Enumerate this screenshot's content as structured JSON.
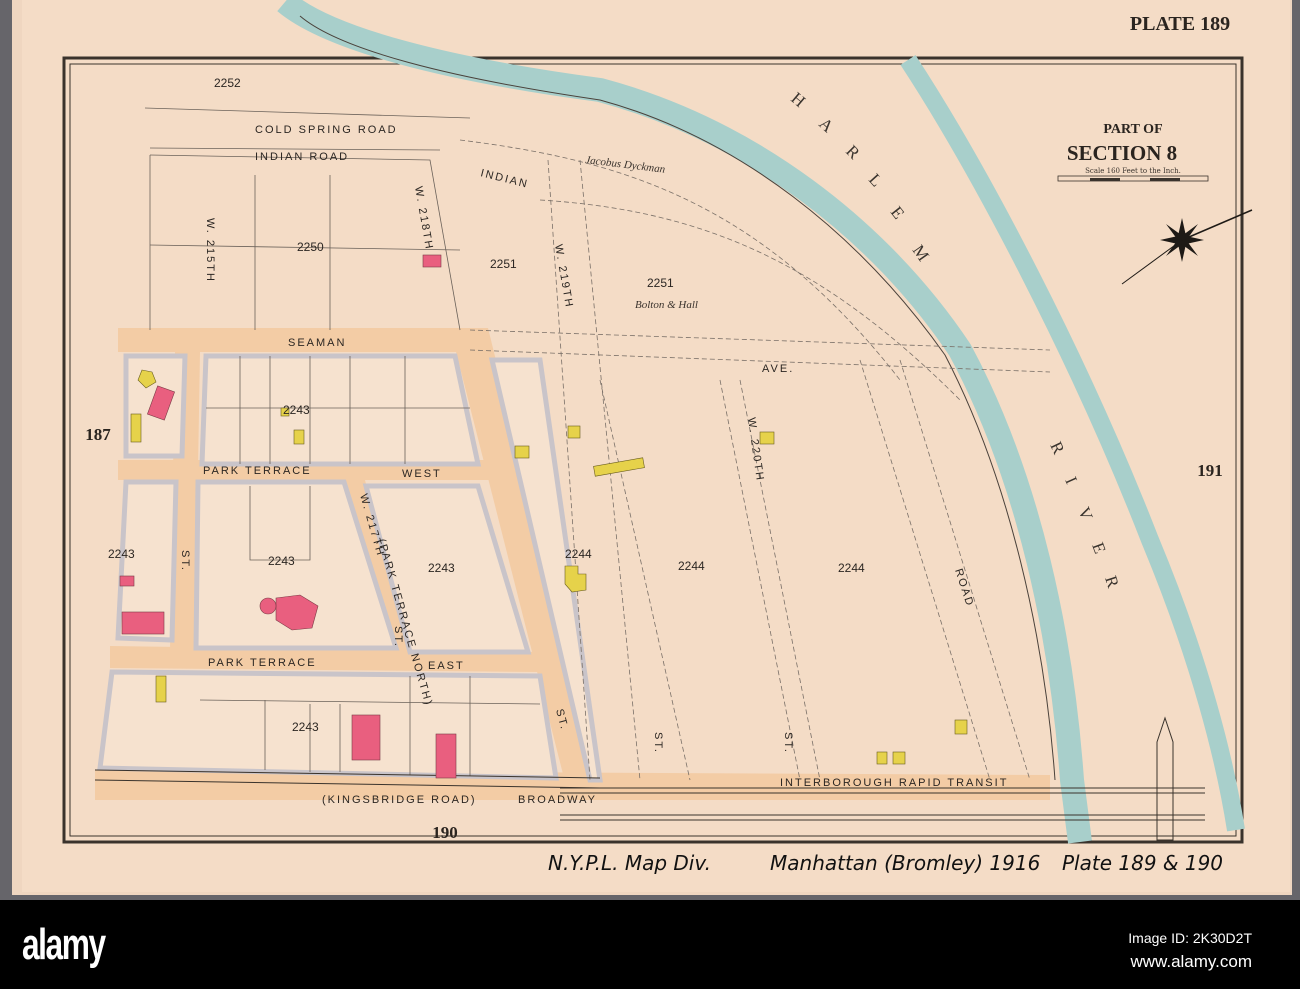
{
  "header": {
    "plate": "PLATE 189",
    "part_of": "PART OF",
    "section": "SECTION 8",
    "scale": "Scale 160 Feet to the Inch."
  },
  "adjacent_plates": {
    "west": "187",
    "east": "191",
    "south": "190"
  },
  "streets": {
    "cold_spring_road": "COLD SPRING ROAD",
    "indian_road": "INDIAN ROAD",
    "indian": "INDIAN",
    "seaman": "SEAMAN",
    "ave": "AVE.",
    "w215": "W. 215TH",
    "w218": "W. 218TH",
    "w219": "W. 219TH",
    "w217": "W. 217TH",
    "park_terrace_north": "(PARK TERRACE NORTH)",
    "w220": "W. 220TH",
    "road": "ROAD",
    "park_terrace": "PARK TERRACE",
    "west": "WEST",
    "east": "EAST",
    "st": "ST.",
    "kingsbridge": "(KINGSBRIDGE ROAD)",
    "broadway": "BROADWAY",
    "transit": "INTERBOROUGH RAPID TRANSIT"
  },
  "water": {
    "harlem": [
      "H",
      "A",
      "R",
      "L",
      "E",
      "M"
    ],
    "river": [
      "R",
      "I",
      "V",
      "E",
      "R"
    ]
  },
  "blocks": {
    "b2252": "2252",
    "b2250": "2250",
    "b2251": "2251",
    "b2243": "2243",
    "b2244": "2244"
  },
  "owners": {
    "dyckman": "Jacobus Dyckman",
    "bolton": "Bolton & Hall"
  },
  "annotation": {
    "nypl": "N.Y.P.L. Map Div.",
    "title": "Manhattan (Bromley) 1916",
    "plates": "Plate 189 & 190"
  },
  "colors": {
    "paper": "#f4dcc6",
    "street": "#f3cca5",
    "curb": "#c9c4c9",
    "river": "#a8cfcb",
    "brick": "#e95f7f",
    "frame": "#e6d24a"
  },
  "watermark": {
    "logo": "alamy",
    "image_id": "Image ID: 2K30D2T",
    "site": "www.alamy.com"
  }
}
